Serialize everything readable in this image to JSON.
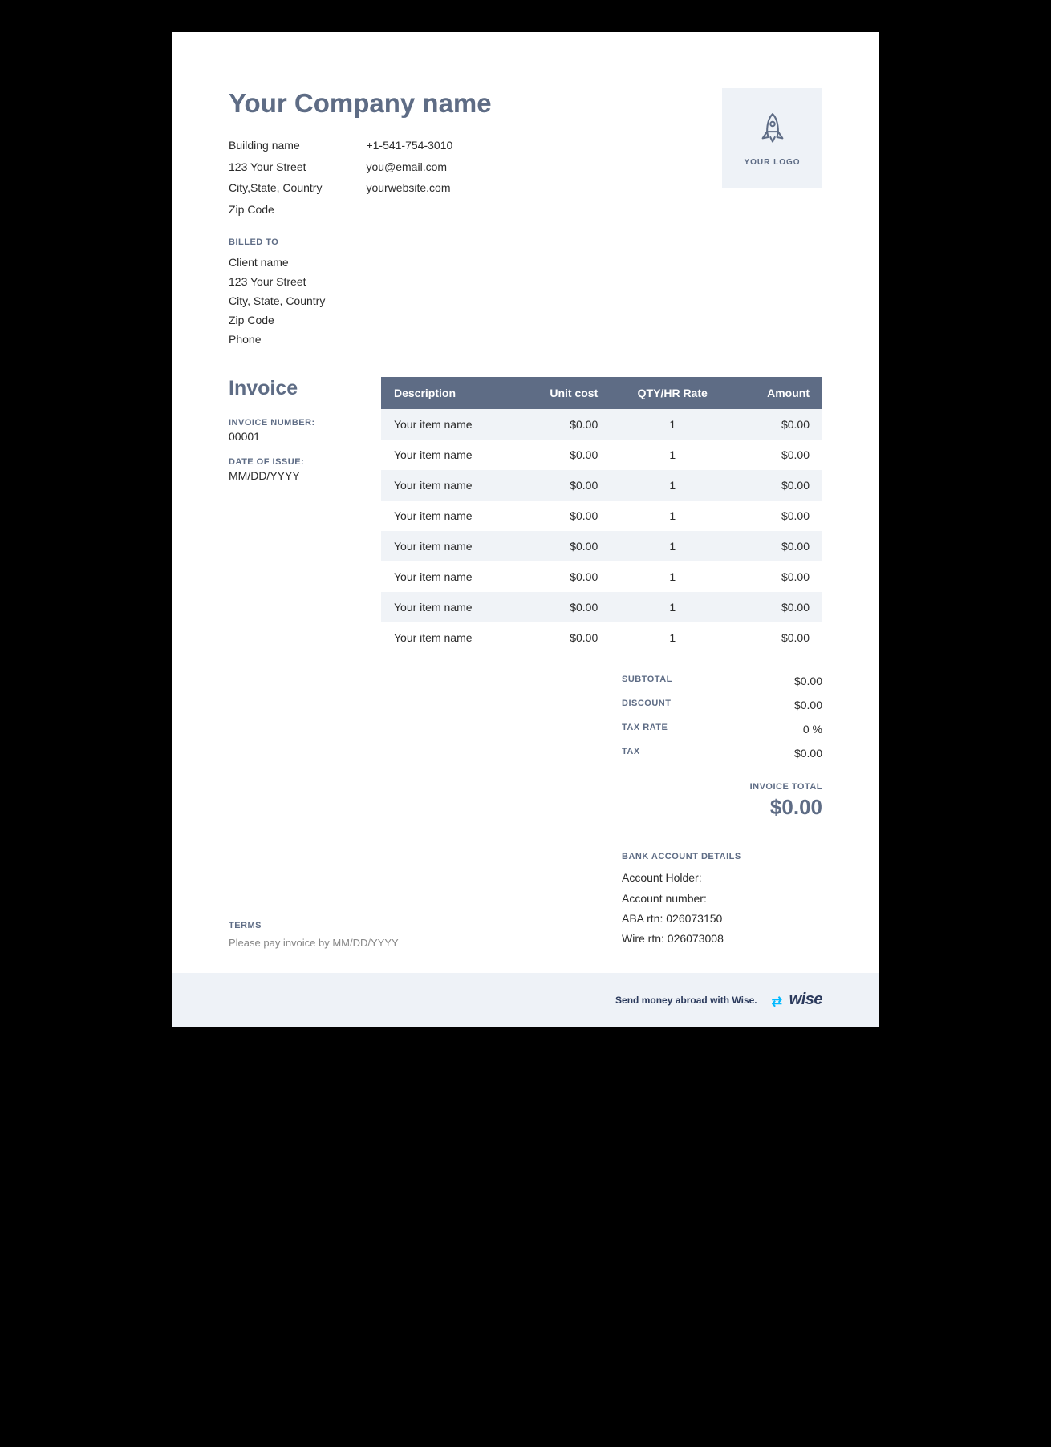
{
  "company": {
    "name": "Your Company name",
    "address": [
      "Building name",
      "123 Your Street",
      "City,State, Country",
      "Zip Code"
    ],
    "contact": [
      "+1-541-754-3010",
      "you@email.com",
      "yourwebsite.com"
    ]
  },
  "logo": {
    "caption": "YOUR LOGO"
  },
  "billed_to": {
    "label": "BILLED TO",
    "lines": [
      "Client name",
      "123 Your Street",
      "City, State, Country",
      "Zip Code",
      "Phone"
    ]
  },
  "invoice": {
    "heading": "Invoice",
    "number_label": "INVOICE NUMBER:",
    "number": "00001",
    "date_label": "DATE OF ISSUE:",
    "date": "MM/DD/YYYY"
  },
  "table": {
    "headers": {
      "desc": "Description",
      "unit": "Unit cost",
      "qty": "QTY/HR Rate",
      "amount": "Amount"
    },
    "rows": [
      {
        "desc": "Your item name",
        "unit": "$0.00",
        "qty": "1",
        "amount": "$0.00"
      },
      {
        "desc": "Your item name",
        "unit": "$0.00",
        "qty": "1",
        "amount": "$0.00"
      },
      {
        "desc": "Your item name",
        "unit": "$0.00",
        "qty": "1",
        "amount": "$0.00"
      },
      {
        "desc": "Your item name",
        "unit": "$0.00",
        "qty": "1",
        "amount": "$0.00"
      },
      {
        "desc": "Your item name",
        "unit": "$0.00",
        "qty": "1",
        "amount": "$0.00"
      },
      {
        "desc": "Your item name",
        "unit": "$0.00",
        "qty": "1",
        "amount": "$0.00"
      },
      {
        "desc": "Your item name",
        "unit": "$0.00",
        "qty": "1",
        "amount": "$0.00"
      },
      {
        "desc": "Your item name",
        "unit": "$0.00",
        "qty": "1",
        "amount": "$0.00"
      }
    ]
  },
  "totals": {
    "subtotal_label": "SUBTOTAL",
    "subtotal": "$0.00",
    "discount_label": "DISCOUNT",
    "discount": "$0.00",
    "taxrate_label": "TAX RATE",
    "taxrate": "0 %",
    "tax_label": "TAX",
    "tax": "$0.00",
    "total_label": "INVOICE TOTAL",
    "total": "$0.00"
  },
  "bank": {
    "label": "BANK ACCOUNT DETAILS",
    "lines": [
      "Account Holder:",
      "Account number:",
      "ABA rtn: 026073150",
      "Wire rtn: 026073008"
    ]
  },
  "terms": {
    "label": "TERMS",
    "text": "Please pay invoice by MM/DD/YYYY"
  },
  "footer": {
    "text": "Send money abroad with Wise.",
    "brand": "wise"
  }
}
